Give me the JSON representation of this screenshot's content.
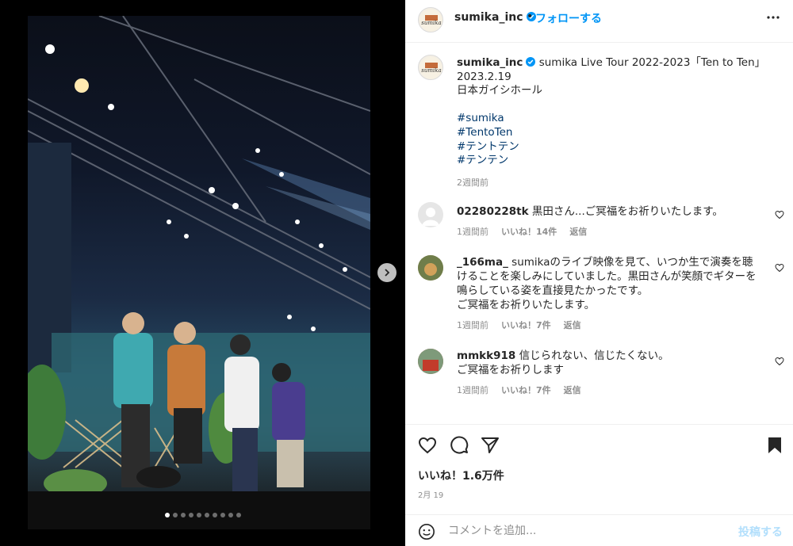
{
  "post": {
    "username": "sumika_inc",
    "follow_label": "フォローする",
    "separator": "•",
    "brand_avatar_text": "sumika",
    "caption": {
      "line1": "sumika Live Tour 2022-2023「Ten to Ten」",
      "line2": "2023.2.19",
      "line3": "日本ガイシホール",
      "hashtags": [
        "#sumika",
        "#TentoTen",
        "#テントテン",
        "#テンテン"
      ],
      "time": "2週間前"
    },
    "carousel": {
      "slide_count": 10,
      "active_index": 0
    }
  },
  "comments": [
    {
      "username": "02280228tk",
      "text": "黒田さん...ご冥福をお祈りいたします。",
      "time": "1週間前",
      "likes": "いいね！14件",
      "reply": "返信"
    },
    {
      "username": "_166ma_",
      "text": "sumikaのライブ映像を見て、いつか生で演奏を聴けることを楽しみにしていました。黒田さんが笑顔でギターを鳴らしている姿を直接見たかったです。",
      "text2": "ご冥福をお祈りいたします。",
      "time": "1週間前",
      "likes": "いいね！7件",
      "reply": "返信"
    },
    {
      "username": "mmkk918",
      "text": "信じられない、信じたくない。",
      "text2": "ご冥福をお祈りします",
      "time": "1週間前",
      "likes": "いいね！7件",
      "reply": "返信"
    }
  ],
  "actions": {
    "likes_label": "いいね！1.6万件",
    "date": "2月 19"
  },
  "composer": {
    "placeholder": "コメントを追加...",
    "post_label": "投稿する"
  },
  "icons": {
    "verified": "verified-badge-icon",
    "more": "more-options-icon",
    "heart": "heart-icon",
    "comment": "comment-icon",
    "share": "share-icon",
    "save": "bookmark-icon",
    "emoji": "emoji-icon",
    "next": "chevron-right-icon"
  },
  "colors": {
    "accent": "#0095f6",
    "hashtag": "#00376b",
    "muted": "#8e8e8e",
    "verified": "#0095f6"
  }
}
